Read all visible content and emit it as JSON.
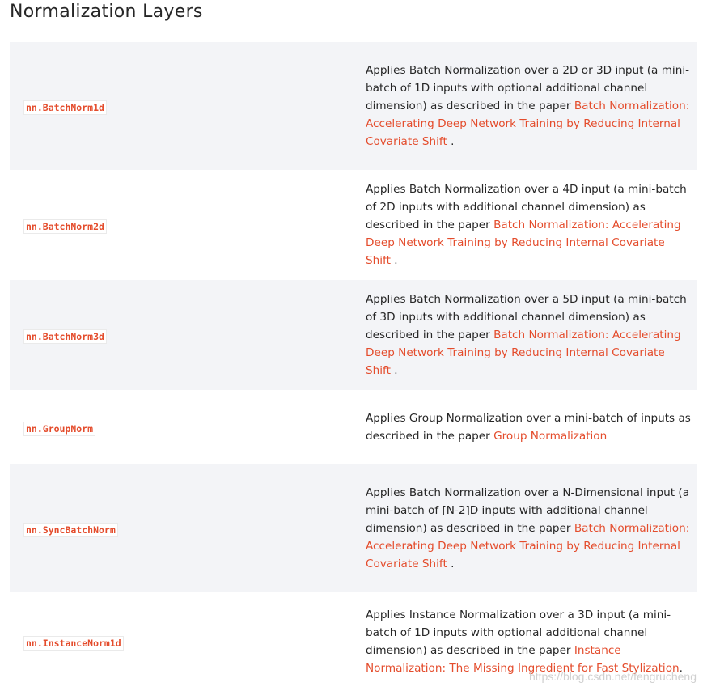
{
  "title": "Normalization Layers",
  "rows": [
    {
      "name": "nn.BatchNorm1d",
      "desc": "Applies Batch Normalization over a 2D or 3D input (a mini-batch of 1D inputs with optional additional channel dimension) as described in the paper ",
      "link": "Batch Normalization: Accelerating Deep Network Training by Reducing Internal Covariate Shift",
      "suffix": " ."
    },
    {
      "name": "nn.BatchNorm2d",
      "desc": "Applies Batch Normalization over a 4D input (a mini-batch of 2D inputs with additional channel dimension) as described in the paper ",
      "link": "Batch Normalization: Accelerating Deep Network Training by Reducing Internal Covariate Shift",
      "suffix": " ."
    },
    {
      "name": "nn.BatchNorm3d",
      "desc": "Applies Batch Normalization over a 5D input (a mini-batch of 3D inputs with additional channel dimension) as described in the paper ",
      "link": "Batch Normalization: Accelerating Deep Network Training by Reducing Internal Covariate Shift",
      "suffix": " ."
    },
    {
      "name": "nn.GroupNorm",
      "desc": "Applies Group Normalization over a mini-batch of inputs as described in the paper ",
      "link": "Group Normalization",
      "suffix": ""
    },
    {
      "name": "nn.SyncBatchNorm",
      "desc": "Applies Batch Normalization over a N-Dimensional input (a mini-batch of [N-2]D inputs with additional channel dimension) as described in the paper ",
      "link": "Batch Normalization: Accelerating Deep Network Training by Reducing Internal Covariate Shift",
      "suffix": " ."
    },
    {
      "name": "nn.InstanceNorm1d",
      "desc": "Applies Instance Normalization over a 3D input (a mini-batch of 1D inputs with optional additional channel dimension) as described in the paper ",
      "link": "Instance Normalization: The Missing Ingredient for Fast Stylization",
      "suffix": "."
    }
  ],
  "watermark": "https://blog.csdn.net/fengrucheng",
  "colors": {
    "link": "#e44c2c",
    "row_alt": "#f3f4f7",
    "text": "#262626"
  }
}
